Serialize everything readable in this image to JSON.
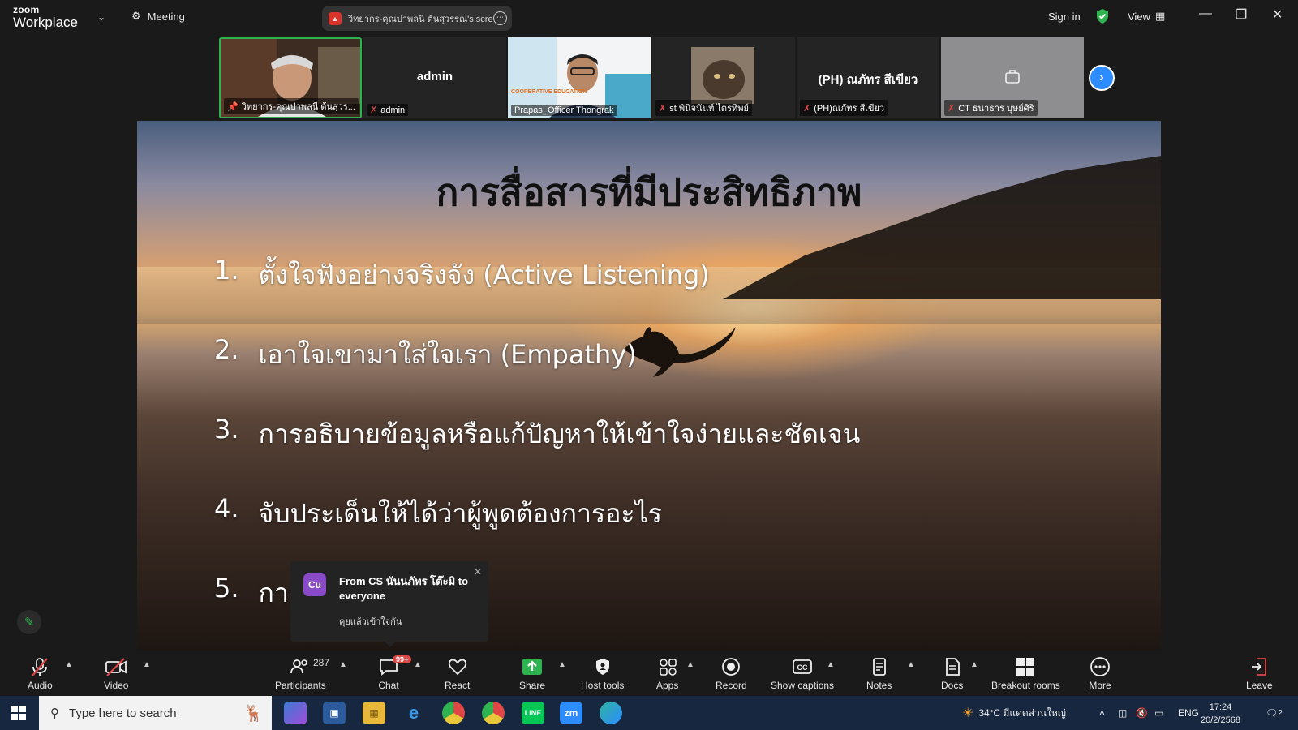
{
  "topbar": {
    "brand_line1": "zoom",
    "brand_line2": "Workplace",
    "meeting_label": "Meeting",
    "share_title": "วิทยากร-คุณปาพลนี ต้นสุวรรณ's scre",
    "sign_in": "Sign in",
    "view_label": "View"
  },
  "participants_strip": [
    {
      "name": "วิทยากร-คุณปาพลนี ต้นสุวร...",
      "video": true,
      "active": true,
      "muted": false
    },
    {
      "name": "admin",
      "big_name": "admin",
      "video": false,
      "muted": true
    },
    {
      "name": "Prapas_Officer Thongrak",
      "video": true,
      "muted": false,
      "bg_text": "COOPERATIVE EDUCATION"
    },
    {
      "name": "st พินิจนันท์ ไตรทิพย์",
      "video": true,
      "muted": true
    },
    {
      "name": "(PH)ณภัทร สีเขียว",
      "big_name": "(PH) ณภัทร สีเขียว",
      "video": false,
      "muted": true
    },
    {
      "name": "CT ธนาธาร บุษย์ศิริ",
      "video": false,
      "muted": true
    }
  ],
  "slide": {
    "title": "การสื่อสารที่มีประสิทธิภาพ",
    "items": [
      {
        "num": "1.",
        "text": "ตั้งใจฟังอย่างจริงจัง (Active Listening)"
      },
      {
        "num": "2.",
        "text": "เอาใจเขามาใส่ใจเรา (Empathy)"
      },
      {
        "num": "3.",
        "text": "การอธิบายข้อมูลหรือแก้ปัญหาให้เข้าใจง่ายและชัดเจน"
      },
      {
        "num": "4.",
        "text": "จับประเด็นให้ได้ว่าผู้พูดต้องการอะไร"
      },
      {
        "num": "5.",
        "text": "การ"
      }
    ]
  },
  "chat_toast": {
    "avatar": "Cu",
    "from": "From CS นันนภัทร โต๊ะมิ to everyone",
    "message": "คุยแล้วเข้าใจกัน"
  },
  "toolbar": {
    "audio": "Audio",
    "video": "Video",
    "participants": "Participants",
    "participants_count": "287",
    "chat": "Chat",
    "chat_badge": "99+",
    "react": "React",
    "share": "Share",
    "host_tools": "Host tools",
    "apps": "Apps",
    "record": "Record",
    "show_captions": "Show captions",
    "notes": "Notes",
    "docs": "Docs",
    "breakout_rooms": "Breakout rooms",
    "more": "More",
    "leave": "Leave"
  },
  "taskbar": {
    "search_placeholder": "Type here to search",
    "weather": "34°C มีแดดส่วนใหญ่",
    "lang": "ENG",
    "time": "17:24",
    "date": "20/2/2568",
    "notif_count": "2"
  },
  "colors": {
    "accent_blue": "#2d8cff",
    "active_green": "#2fb350",
    "muted_red": "#e04646"
  }
}
